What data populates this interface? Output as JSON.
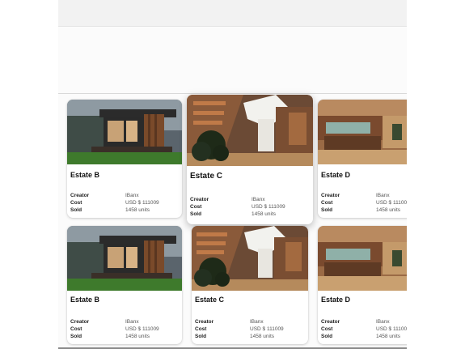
{
  "cards": [
    {
      "title": "Estate B",
      "scene": "exterior",
      "creator_label": "Creator",
      "creator": "IBanx",
      "cost_label": "Cost",
      "cost": "USD $ 111009",
      "sold_label": "Sold",
      "sold": "1458 units"
    },
    {
      "title": "Estate C",
      "scene": "atrium",
      "creator_label": "Creator",
      "creator": "IBanx",
      "cost_label": "Cost",
      "cost": "USD $ 111009",
      "sold_label": "Sold",
      "sold": "1458 units"
    },
    {
      "title": "Estate D",
      "scene": "interior",
      "creator_label": "Creator",
      "creator": "IBanx",
      "cost_label": "Cost",
      "cost": "USD $ 11100",
      "sold_label": "Sold",
      "sold": "1458 units"
    },
    {
      "title": "Estate B",
      "scene": "exterior",
      "creator_label": "Creator",
      "creator": "IBanx",
      "cost_label": "Cost",
      "cost": "USD $ 111009",
      "sold_label": "Sold",
      "sold": "1458 units"
    },
    {
      "title": "Estate C",
      "scene": "atrium",
      "creator_label": "Creator",
      "creator": "IBanx",
      "cost_label": "Cost",
      "cost": "USD $ 111009",
      "sold_label": "Sold",
      "sold": "1458 units"
    },
    {
      "title": "Estate D",
      "scene": "interior",
      "creator_label": "Creator",
      "creator": "IBanx",
      "cost_label": "Cost",
      "cost": "USD $ 11100",
      "sold_label": "Sold",
      "sold": "1458 units"
    }
  ]
}
